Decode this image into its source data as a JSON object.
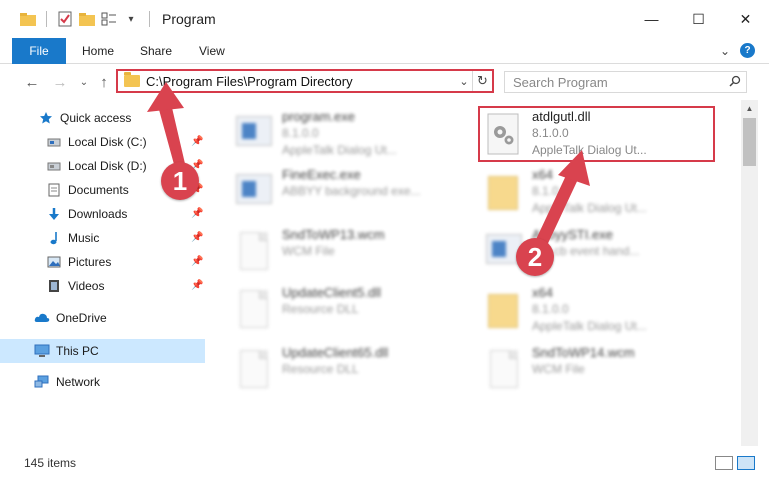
{
  "window": {
    "title": "Program",
    "minimize": "—",
    "maximize": "☐",
    "close": "✕"
  },
  "ribbon": {
    "tabs": [
      "File",
      "Home",
      "Share",
      "View"
    ],
    "expand": "⌄",
    "help": "?"
  },
  "address": {
    "path": "C:\\Program Files\\Program Directory",
    "dropdown": "⌄",
    "refresh": "↻"
  },
  "search": {
    "placeholder": "Search Program",
    "icon": "search-icon"
  },
  "nav": {
    "back": "←",
    "forward": "→",
    "recent": "⌄",
    "up": "↑"
  },
  "sidebar": {
    "items": [
      {
        "label": "Quick access",
        "icon": "star-icon"
      },
      {
        "label": "Local Disk (C:)",
        "icon": "drive-icon"
      },
      {
        "label": "Local Disk (D:)",
        "icon": "drive-icon"
      },
      {
        "label": "Documents",
        "icon": "documents-icon"
      },
      {
        "label": "Downloads",
        "icon": "download-icon"
      },
      {
        "label": "Music",
        "icon": "music-icon"
      },
      {
        "label": "Pictures",
        "icon": "pictures-icon"
      },
      {
        "label": "Videos",
        "icon": "videos-icon"
      },
      {
        "label": "OneDrive",
        "icon": "cloud-icon"
      },
      {
        "label": "This PC",
        "icon": "computer-icon"
      },
      {
        "label": "Network",
        "icon": "network-icon"
      }
    ]
  },
  "files": [
    {
      "name": "program.exe",
      "version": "8.1.0.0",
      "desc": "AppleTalk Dialog Ut..."
    },
    {
      "name": "atdlgutl.dll",
      "version": "8.1.0.0",
      "desc": "AppleTalk Dialog Ut..."
    },
    {
      "name": "FineExec.exe",
      "version": "",
      "desc": "ABBYY background exe..."
    },
    {
      "name": "x64",
      "version": "8.1.0.0",
      "desc": "AppleTalk Dialog Ut..."
    },
    {
      "name": "SndToWP13.wcm",
      "version": "",
      "desc": "WCM File"
    },
    {
      "name": "AbbyySTI.exe",
      "version": "",
      "desc": "STI cb event hand..."
    },
    {
      "name": "UpdateClient5.dll",
      "version": "",
      "desc": "Resource DLL"
    },
    {
      "name": "x64",
      "version": "8.1.0.0",
      "desc": "AppleTalk Dialog Ut..."
    },
    {
      "name": "UpdateClient65.dll",
      "version": "",
      "desc": "Resource DLL"
    },
    {
      "name": "SndToWP14.wcm",
      "version": "",
      "desc": "WCM File"
    }
  ],
  "status": {
    "count": "145 items"
  },
  "annotations": {
    "step1": "1",
    "step2": "2"
  },
  "colors": {
    "accent": "#1979ca",
    "highlight": "#d63a4a",
    "selected": "#cce8ff"
  }
}
